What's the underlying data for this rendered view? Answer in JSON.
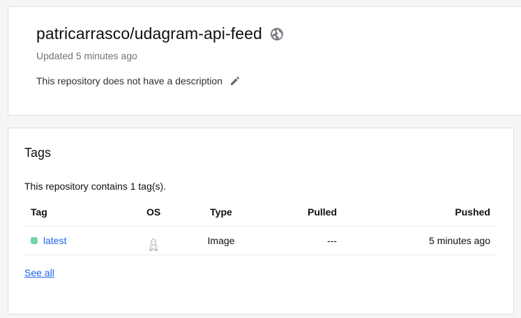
{
  "repo": {
    "title": "patricarrasco/udagram-api-feed",
    "updated": "Updated 5 minutes ago",
    "description": "This repository does not have a description",
    "visibility_icon": "globe-icon",
    "edit_icon": "pencil-icon"
  },
  "tags": {
    "heading": "Tags",
    "count_text": "This repository contains 1 tag(s).",
    "columns": {
      "tag": "Tag",
      "os": "OS",
      "type": "Type",
      "pulled": "Pulled",
      "pushed": "Pushed"
    },
    "rows": [
      {
        "tag": "latest",
        "os_icon": "linux-icon",
        "type": "Image",
        "pulled": "---",
        "pushed": "5 minutes ago",
        "status_color": "#76d2aa"
      }
    ],
    "see_all": "See all"
  },
  "colors": {
    "link": "#1d63ed",
    "muted": "#6e7175",
    "status_active": "#76d2aa"
  }
}
